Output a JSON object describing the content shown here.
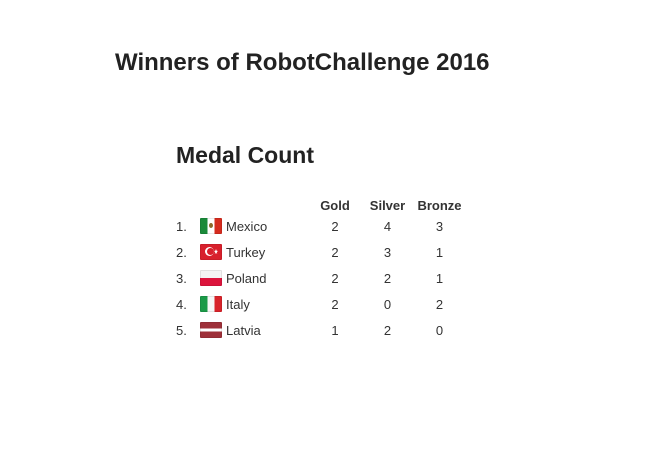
{
  "page": {
    "title": "Winners of RobotChallenge 2016"
  },
  "medal_count": {
    "heading": "Medal Count",
    "columns": {
      "gold": "Gold",
      "silver": "Silver",
      "bronze": "Bronze"
    },
    "rows": [
      {
        "rank": "1.",
        "country": "Mexico",
        "flag": "mexico-flag-icon",
        "gold": "2",
        "silver": "4",
        "bronze": "3"
      },
      {
        "rank": "2.",
        "country": "Turkey",
        "flag": "turkey-flag-icon",
        "gold": "2",
        "silver": "3",
        "bronze": "1"
      },
      {
        "rank": "3.",
        "country": "Poland",
        "flag": "poland-flag-icon",
        "gold": "2",
        "silver": "2",
        "bronze": "1"
      },
      {
        "rank": "4.",
        "country": "Italy",
        "flag": "italy-flag-icon",
        "gold": "2",
        "silver": "0",
        "bronze": "2"
      },
      {
        "rank": "5.",
        "country": "Latvia",
        "flag": "latvia-flag-icon",
        "gold": "1",
        "silver": "2",
        "bronze": "0"
      }
    ]
  }
}
